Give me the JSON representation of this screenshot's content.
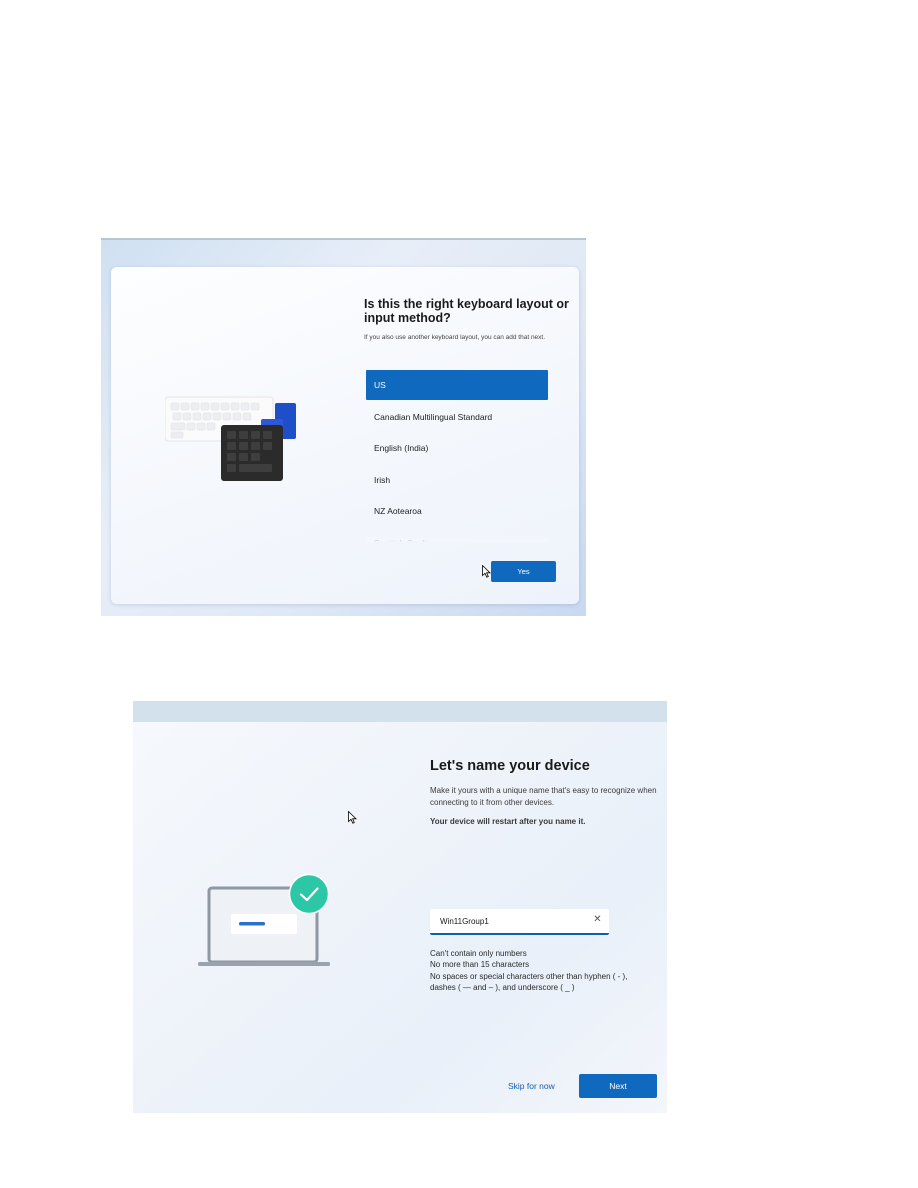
{
  "keyboard_screen": {
    "title": "Is this the right keyboard layout or input method?",
    "subtitle": "If you also use another keyboard layout, you can add that next.",
    "layouts": [
      {
        "label": "US",
        "selected": true
      },
      {
        "label": "Canadian Multilingual Standard",
        "selected": false
      },
      {
        "label": "English (India)",
        "selected": false
      },
      {
        "label": "Irish",
        "selected": false
      },
      {
        "label": "NZ Aotearoa",
        "selected": false
      },
      {
        "label": "Scottish Gaelic",
        "selected": false
      }
    ],
    "yes_label": "Yes",
    "accent_color": "#0f69be"
  },
  "device_name_screen": {
    "title": "Let's name your device",
    "subtitle": "Make it yours with a unique name that's easy to recognize when connecting to it from other devices.",
    "warning": "Your device will restart after you name it.",
    "name_value": "Win11Group1",
    "clear_icon": "close-icon",
    "rules": [
      "Can't contain only numbers",
      "No more than 15 characters",
      "No spaces or special characters other than hyphen ( - ), dashes ( — and – ), and underscore ( _ )"
    ],
    "skip_label": "Skip for now",
    "next_label": "Next",
    "accent_color": "#0f69be",
    "check_color": "#2cc7a7"
  }
}
